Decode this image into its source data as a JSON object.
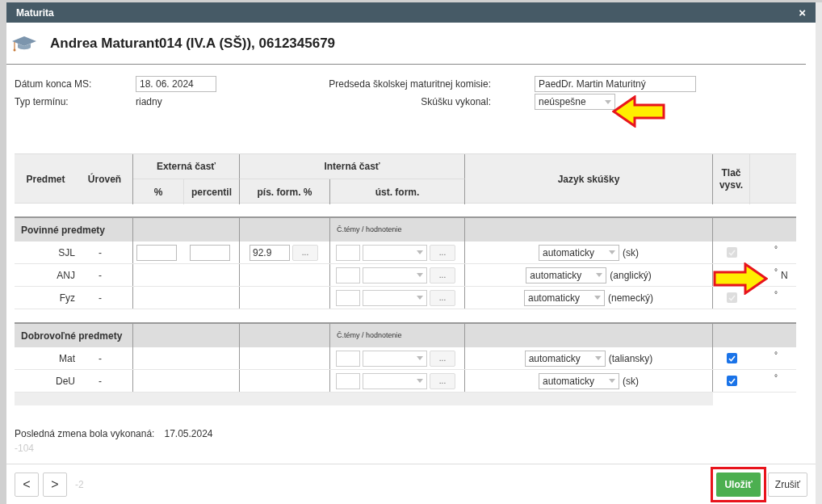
{
  "window": {
    "title": "Maturita",
    "close": "×"
  },
  "student": {
    "heading": "Andrea Maturant014 (IV.A (SŠ)), 0612345679"
  },
  "form": {
    "end_date_label": "Dátum konca MS:",
    "end_date": "18. 06. 2024",
    "term_type_label": "Typ termínu:",
    "term_type": "riadny",
    "chair_label": "Predseda školskej maturitnej komisie:",
    "chair": "PaedDr. Martin Maturitný",
    "result_label": "Skúšku vykonal:",
    "result": "neúspešne"
  },
  "table": {
    "columns": {
      "subject": "Predmet",
      "level": "Úroveň",
      "external": "Externá časť",
      "external_percent": "%",
      "percentile": "percentil",
      "internal": "Interná časť",
      "written": "pís. form. %",
      "oral": "úst. form.",
      "language": "Jazyk skúšky",
      "print": "Tlač vysv."
    },
    "groups": [
      {
        "title": "Povinné predmety",
        "topic_hint": "Č.témy / hodnotenie",
        "rows": [
          {
            "subject": "SJL",
            "level": "-",
            "external_inputs": true,
            "written": "92.9",
            "written_button": "...",
            "oral_button": "...",
            "language_select": "automaticky",
            "language": "(sk)",
            "print": {
              "checked": true,
              "disabled": true
            },
            "mark": "°"
          },
          {
            "subject": "ANJ",
            "level": "-",
            "external_inputs": false,
            "oral_button": "...",
            "language_select": "automaticky",
            "language": "(anglický)",
            "mark": "°",
            "note": "N"
          },
          {
            "subject": "Fyz",
            "level": "-",
            "external_inputs": false,
            "oral_button": "...",
            "language_select": "automaticky",
            "language": "(nemecký)",
            "print": {
              "checked": true,
              "disabled": true
            },
            "mark": "°"
          }
        ]
      },
      {
        "title": "Dobrovoľné predmety",
        "topic_hint": "Č.témy / hodnotenie",
        "rows": [
          {
            "subject": "Mat",
            "level": "-",
            "external_inputs": false,
            "oral_button": "...",
            "language_select": "automaticky",
            "language": "(taliansky)",
            "print": {
              "checked": true,
              "disabled": false
            },
            "mark": "°"
          },
          {
            "subject": "DeU",
            "level": "-",
            "external_inputs": false,
            "oral_button": "...",
            "language_select": "automaticky",
            "language": "(sk)",
            "print": {
              "checked": true,
              "disabled": false
            },
            "mark": "°"
          }
        ]
      }
    ]
  },
  "last_change": {
    "label": "Posledná zmena bola vykonaná:",
    "date": "17.05.2024",
    "code": "-104"
  },
  "footer": {
    "prev": "<",
    "next": ">",
    "index": "-2",
    "save": "Uložiť",
    "cancel": "Zrušiť"
  }
}
